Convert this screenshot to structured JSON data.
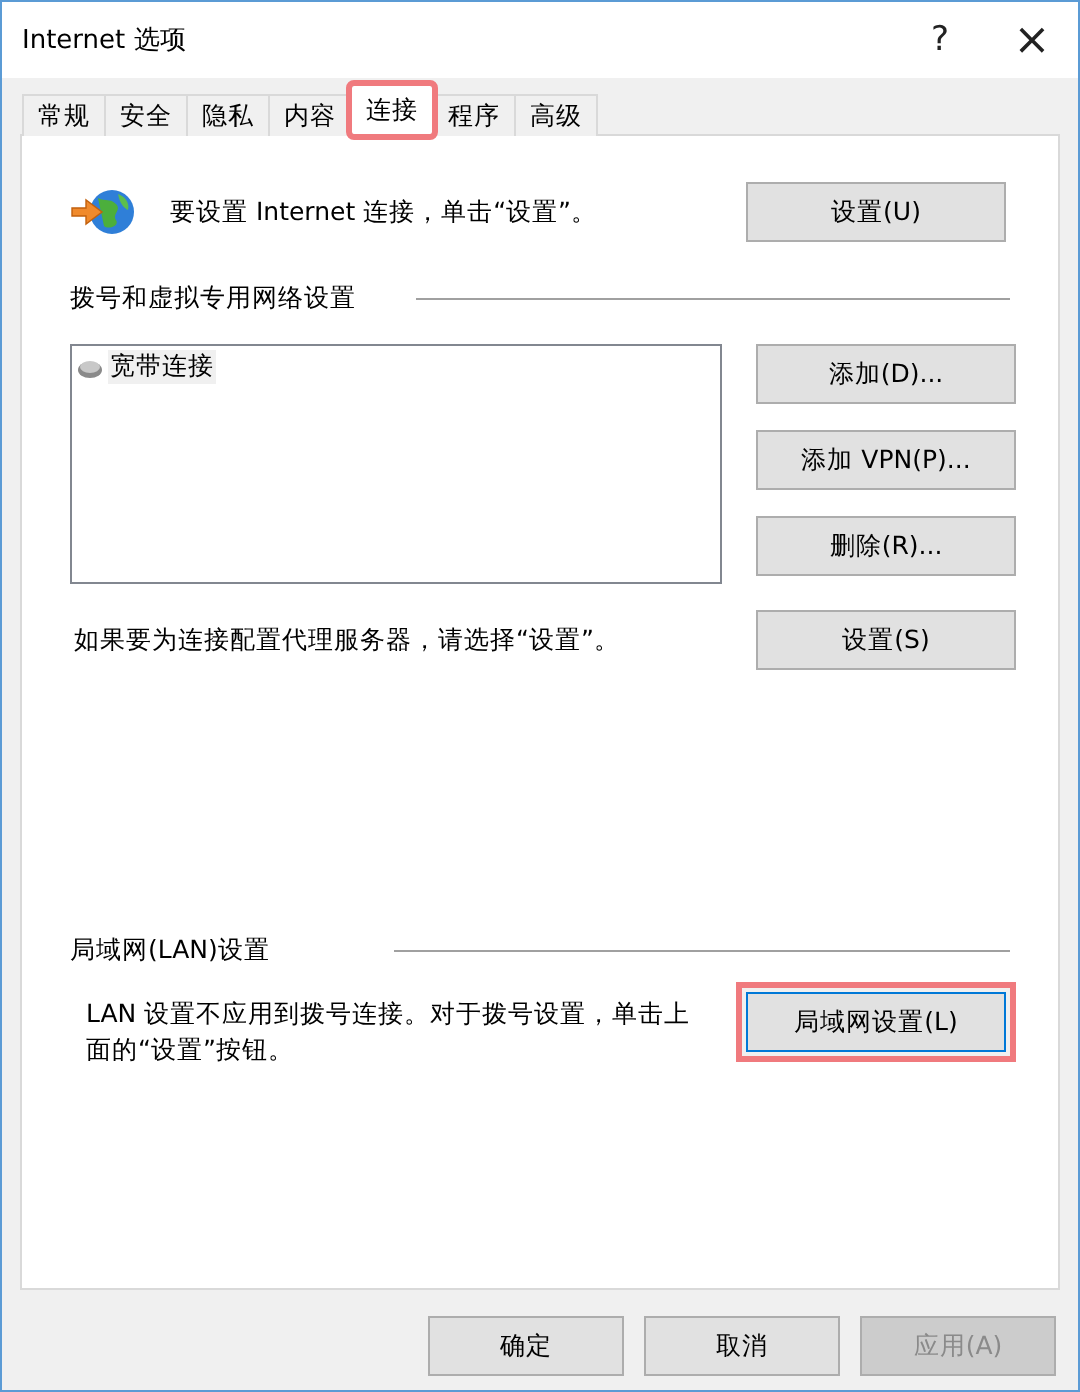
{
  "window": {
    "title": "Internet 选项",
    "help": "?",
    "close": "×"
  },
  "tabs": [
    {
      "label": "常规",
      "selected": false,
      "highlighted": false
    },
    {
      "label": "安全",
      "selected": false,
      "highlighted": false
    },
    {
      "label": "隐私",
      "selected": false,
      "highlighted": false
    },
    {
      "label": "内容",
      "selected": false,
      "highlighted": false
    },
    {
      "label": "连接",
      "selected": true,
      "highlighted": true
    },
    {
      "label": "程序",
      "selected": false,
      "highlighted": false
    },
    {
      "label": "高级",
      "selected": false,
      "highlighted": false
    }
  ],
  "setup": {
    "text": "要设置 Internet 连接，单击“设置”。",
    "button": "设置(U)"
  },
  "dialup": {
    "heading": "拨号和虚拟专用网络设置",
    "connections": [
      {
        "label": "宽带连接",
        "selected": true
      }
    ],
    "buttons": [
      {
        "label": "添加(D)...",
        "disabled": false
      },
      {
        "label": "添加 VPN(P)...",
        "disabled": false
      },
      {
        "label": "删除(R)...",
        "disabled": false
      }
    ],
    "proxy_text": "如果要为连接配置代理服务器，请选择“设置”。",
    "proxy_button": "设置(S)"
  },
  "lan": {
    "heading": "局域网(LAN)设置",
    "text": "LAN 设置不应用到拨号连接。对于拨号设置，单击上面的“设置”按钮。",
    "button": {
      "label": "局域网设置(L)",
      "highlighted": true,
      "focused": true
    }
  },
  "footer": [
    {
      "label": "确定",
      "disabled": false
    },
    {
      "label": "取消",
      "disabled": false
    },
    {
      "label": "应用(A)",
      "disabled": true
    }
  ]
}
